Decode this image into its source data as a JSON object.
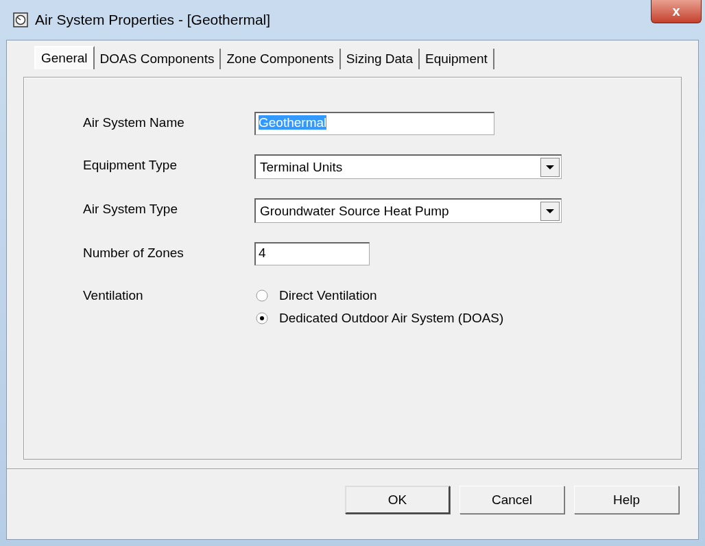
{
  "window": {
    "title": "Air System Properties - [Geothermal]",
    "close_label": "x"
  },
  "tabs": [
    {
      "label": "General",
      "selected": true
    },
    {
      "label": "DOAS Components",
      "selected": false
    },
    {
      "label": "Zone Components",
      "selected": false
    },
    {
      "label": "Sizing Data",
      "selected": false
    },
    {
      "label": "Equipment",
      "selected": false
    }
  ],
  "fields": [
    {
      "kind": "text",
      "label": "Air System Name",
      "value": "Geothermal",
      "text_selected": true
    },
    {
      "kind": "dropdown",
      "label": "Equipment Type",
      "value": "Terminal Units"
    },
    {
      "kind": "dropdown",
      "label": "Air System Type",
      "value": "Groundwater Source Heat Pump"
    },
    {
      "kind": "text",
      "label": "Number of Zones",
      "value": "4",
      "text_selected": false
    },
    {
      "kind": "radio",
      "label": "Ventilation",
      "options": [
        {
          "label": "Direct Ventilation",
          "selected": false
        },
        {
          "label": "Dedicated Outdoor Air System (DOAS)",
          "selected": true
        }
      ]
    }
  ],
  "buttons": [
    {
      "label": "OK",
      "default": true
    },
    {
      "label": "Cancel",
      "default": false
    },
    {
      "label": "Help",
      "default": false
    }
  ]
}
